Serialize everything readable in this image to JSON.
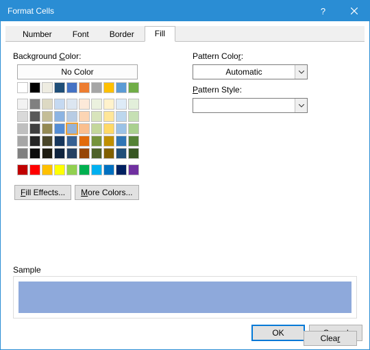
{
  "window": {
    "title": "Format Cells"
  },
  "tabs": {
    "items": [
      {
        "label": "Number"
      },
      {
        "label": "Font"
      },
      {
        "label": "Border"
      },
      {
        "label": "Fill"
      }
    ]
  },
  "bg": {
    "label": "Background Color:",
    "none_label": "No Color",
    "row1": [
      "#ffffff",
      "#000000",
      "#eeece1",
      "#1f4e78",
      "#4472c4",
      "#ed7d31",
      "#a5a5a5",
      "#ffc000",
      "#5b9bd5",
      "#70ad47"
    ],
    "grid": [
      "#f2f2f2",
      "#808080",
      "#ddd9c3",
      "#c5d9f1",
      "#dce6f1",
      "#fde9d9",
      "#ebf1de",
      "#fff2cc",
      "#deebf7",
      "#e2efda",
      "#d9d9d9",
      "#595959",
      "#c4bd97",
      "#8db4e2",
      "#b8cce4",
      "#fcd5b4",
      "#d8e4bc",
      "#ffe699",
      "#bdd7ee",
      "#c6e0b4",
      "#bfbfbf",
      "#404040",
      "#948a54",
      "#538dd5",
      "#95b3d7",
      "#fabf8f",
      "#c4d79b",
      "#ffd966",
      "#9bc2e6",
      "#a9d08e",
      "#a6a6a6",
      "#262626",
      "#494529",
      "#16365c",
      "#366092",
      "#e26b0a",
      "#76933c",
      "#bf8f00",
      "#2f75b5",
      "#548235",
      "#808080",
      "#0d0d0d",
      "#1d1b10",
      "#0f243e",
      "#244062",
      "#974706",
      "#4f6228",
      "#806000",
      "#1f4e78",
      "#375623"
    ],
    "standard": [
      "#c00000",
      "#ff0000",
      "#ffc000",
      "#ffff00",
      "#92d050",
      "#00b050",
      "#00b0f0",
      "#0070c0",
      "#002060",
      "#7030a0"
    ],
    "selected_hex": "#95b3d7",
    "fill_effects_label": "Fill Effects...",
    "more_colors_label": "More Colors..."
  },
  "pattern": {
    "color_label": "Pattern Color:",
    "color_value": "Automatic",
    "style_label": "Pattern Style:",
    "style_value": ""
  },
  "sample": {
    "label": "Sample",
    "color": "#8ea9db"
  },
  "buttons": {
    "clear": "Clear",
    "ok": "OK",
    "cancel": "Cancel"
  }
}
